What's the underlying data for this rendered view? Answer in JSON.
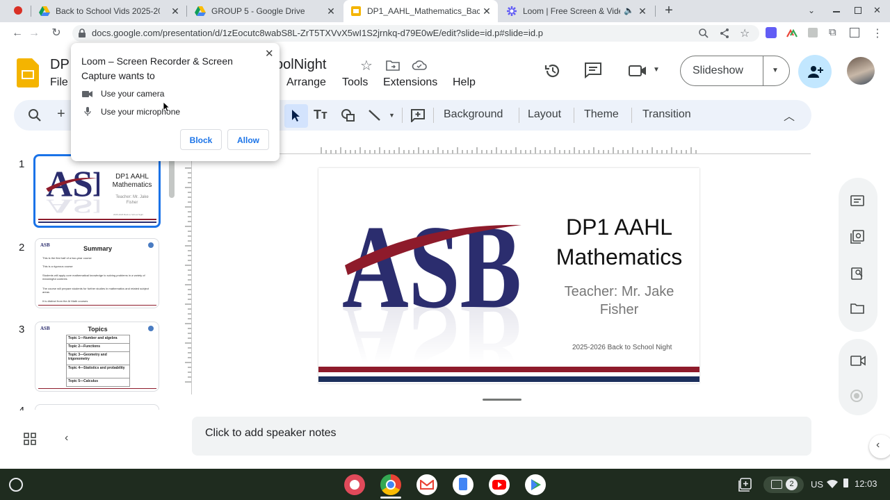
{
  "browser": {
    "tabs": [
      {
        "title": "Back to School Vids 2025-2026",
        "active": false
      },
      {
        "title": "GROUP 5 - Google Drive",
        "active": false
      },
      {
        "title": "DP1_AAHL_Mathematics_Backto",
        "active": true
      },
      {
        "title": "Loom | Free Screen & Video",
        "active": false
      }
    ],
    "new_tab_label": "+",
    "url": "docs.google.com/presentation/d/1zEocutc8wabS8L-ZrT5TXVvX5wI1S2jrnkq-d79E0wE/edit?slide=id.p#slide=id.p"
  },
  "permission_popup": {
    "title": "Loom – Screen Recorder & Screen Capture wants to",
    "items": [
      "Use your camera",
      "Use your microphone"
    ],
    "block_label": "Block",
    "allow_label": "Allow"
  },
  "docs": {
    "title_start": "DP",
    "title_end": "oolNight",
    "menus": [
      "File",
      "Arrange",
      "Tools",
      "Extensions",
      "Help"
    ],
    "slideshow_label": "Slideshow",
    "toolbar": [
      "Background",
      "Layout",
      "Theme",
      "Transition"
    ],
    "notes_placeholder": "Click to add speaker notes"
  },
  "slides": {
    "numbers": [
      "1",
      "2",
      "3",
      "4"
    ],
    "thumb1": {
      "title": "DP1 AAHL Mathematics",
      "teacher": "Teacher: Mr. Jake Fisher",
      "footer": "2025-2026 Back to School Night"
    },
    "thumb2": {
      "title": "Summary",
      "bullets": [
        "This is the first half of a two-year course",
        "This is a rigorous course",
        "Students will apply core mathematical knowledge to solving problems in a variety of meaningful contexts",
        "The course will prepare students for further studies in mathematics and related subject areas",
        "It is distinct from the AI Math courses"
      ]
    },
    "thumb3": {
      "title": "Topics",
      "rows": [
        "Topic 1—Number and algebra",
        "Topic 2—Functions",
        "Topic 3—Geometry and trigonometry",
        "Topic 4—Statistics and probability",
        "Topic 5—Calculus"
      ]
    },
    "main": {
      "line1": "DP1 AAHL",
      "line2": "Mathematics",
      "teacher1": "Teacher: Mr. Jake",
      "teacher2": "Fisher",
      "footer": "2025-2026 Back to School Night",
      "logo_text": "ASB"
    }
  },
  "shelf": {
    "keyboard": "US",
    "notification_count": "2",
    "time": "12:03"
  },
  "colors": {
    "asb_navy": "#2b2d6e",
    "asb_red": "#8e1b2b",
    "selection_blue": "#1a73e8"
  }
}
